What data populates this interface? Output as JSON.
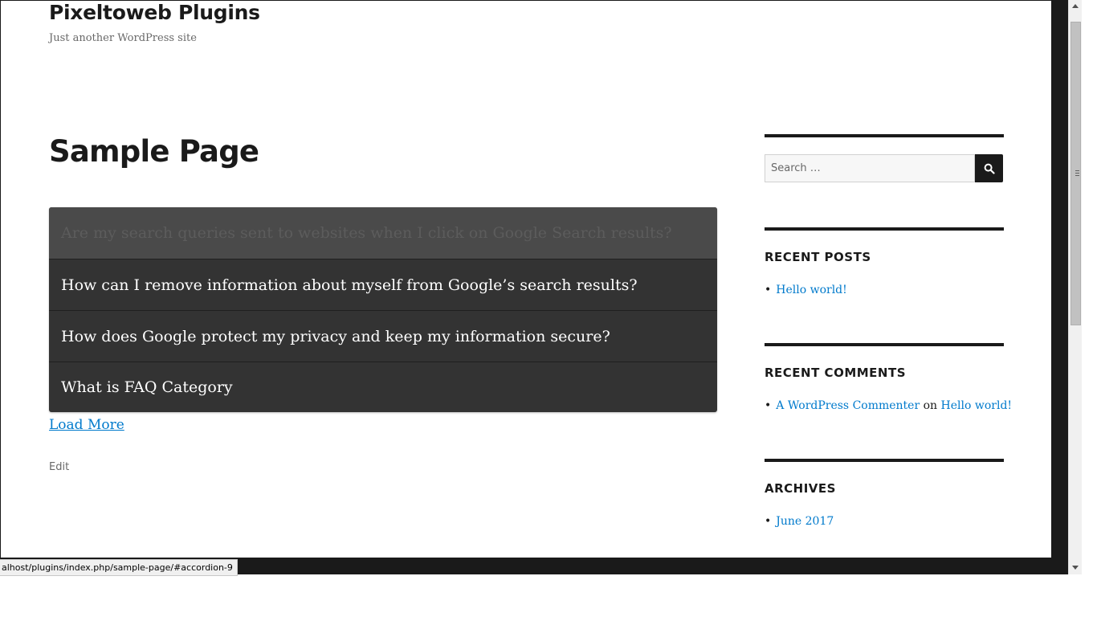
{
  "site": {
    "title": "Pixeltoweb Plugins",
    "tagline": "Just another WordPress site"
  },
  "page": {
    "title": "Sample Page",
    "load_more": "Load More",
    "edit": "Edit"
  },
  "faq": {
    "items": [
      {
        "question": "Are my search queries sent to websites when I click on Google Search results?"
      },
      {
        "question": "How can I remove information about myself from Google’s search results?"
      },
      {
        "question": "How does Google protect my privacy and keep my information secure?"
      },
      {
        "question": "What is FAQ Category"
      }
    ]
  },
  "sidebar": {
    "search": {
      "placeholder": "Search …",
      "icon": "search-icon"
    },
    "recent_posts": {
      "title": "RECENT POSTS",
      "items": [
        {
          "label": "Hello world!"
        }
      ]
    },
    "recent_comments": {
      "title": "RECENT COMMENTS",
      "items": [
        {
          "author": "A WordPress Commenter",
          "connector": "on",
          "post": "Hello world!"
        }
      ]
    },
    "archives": {
      "title": "ARCHIVES",
      "items": [
        {
          "label": "June 2017"
        }
      ]
    }
  },
  "status_bar": {
    "url": "alhost/plugins/index.php/sample-page/#accordion-9"
  },
  "colors": {
    "accordion_bg": "#333333",
    "accordion_hover": "#4a4a4a",
    "link": "#007acc",
    "text": "#1a1a1a"
  }
}
